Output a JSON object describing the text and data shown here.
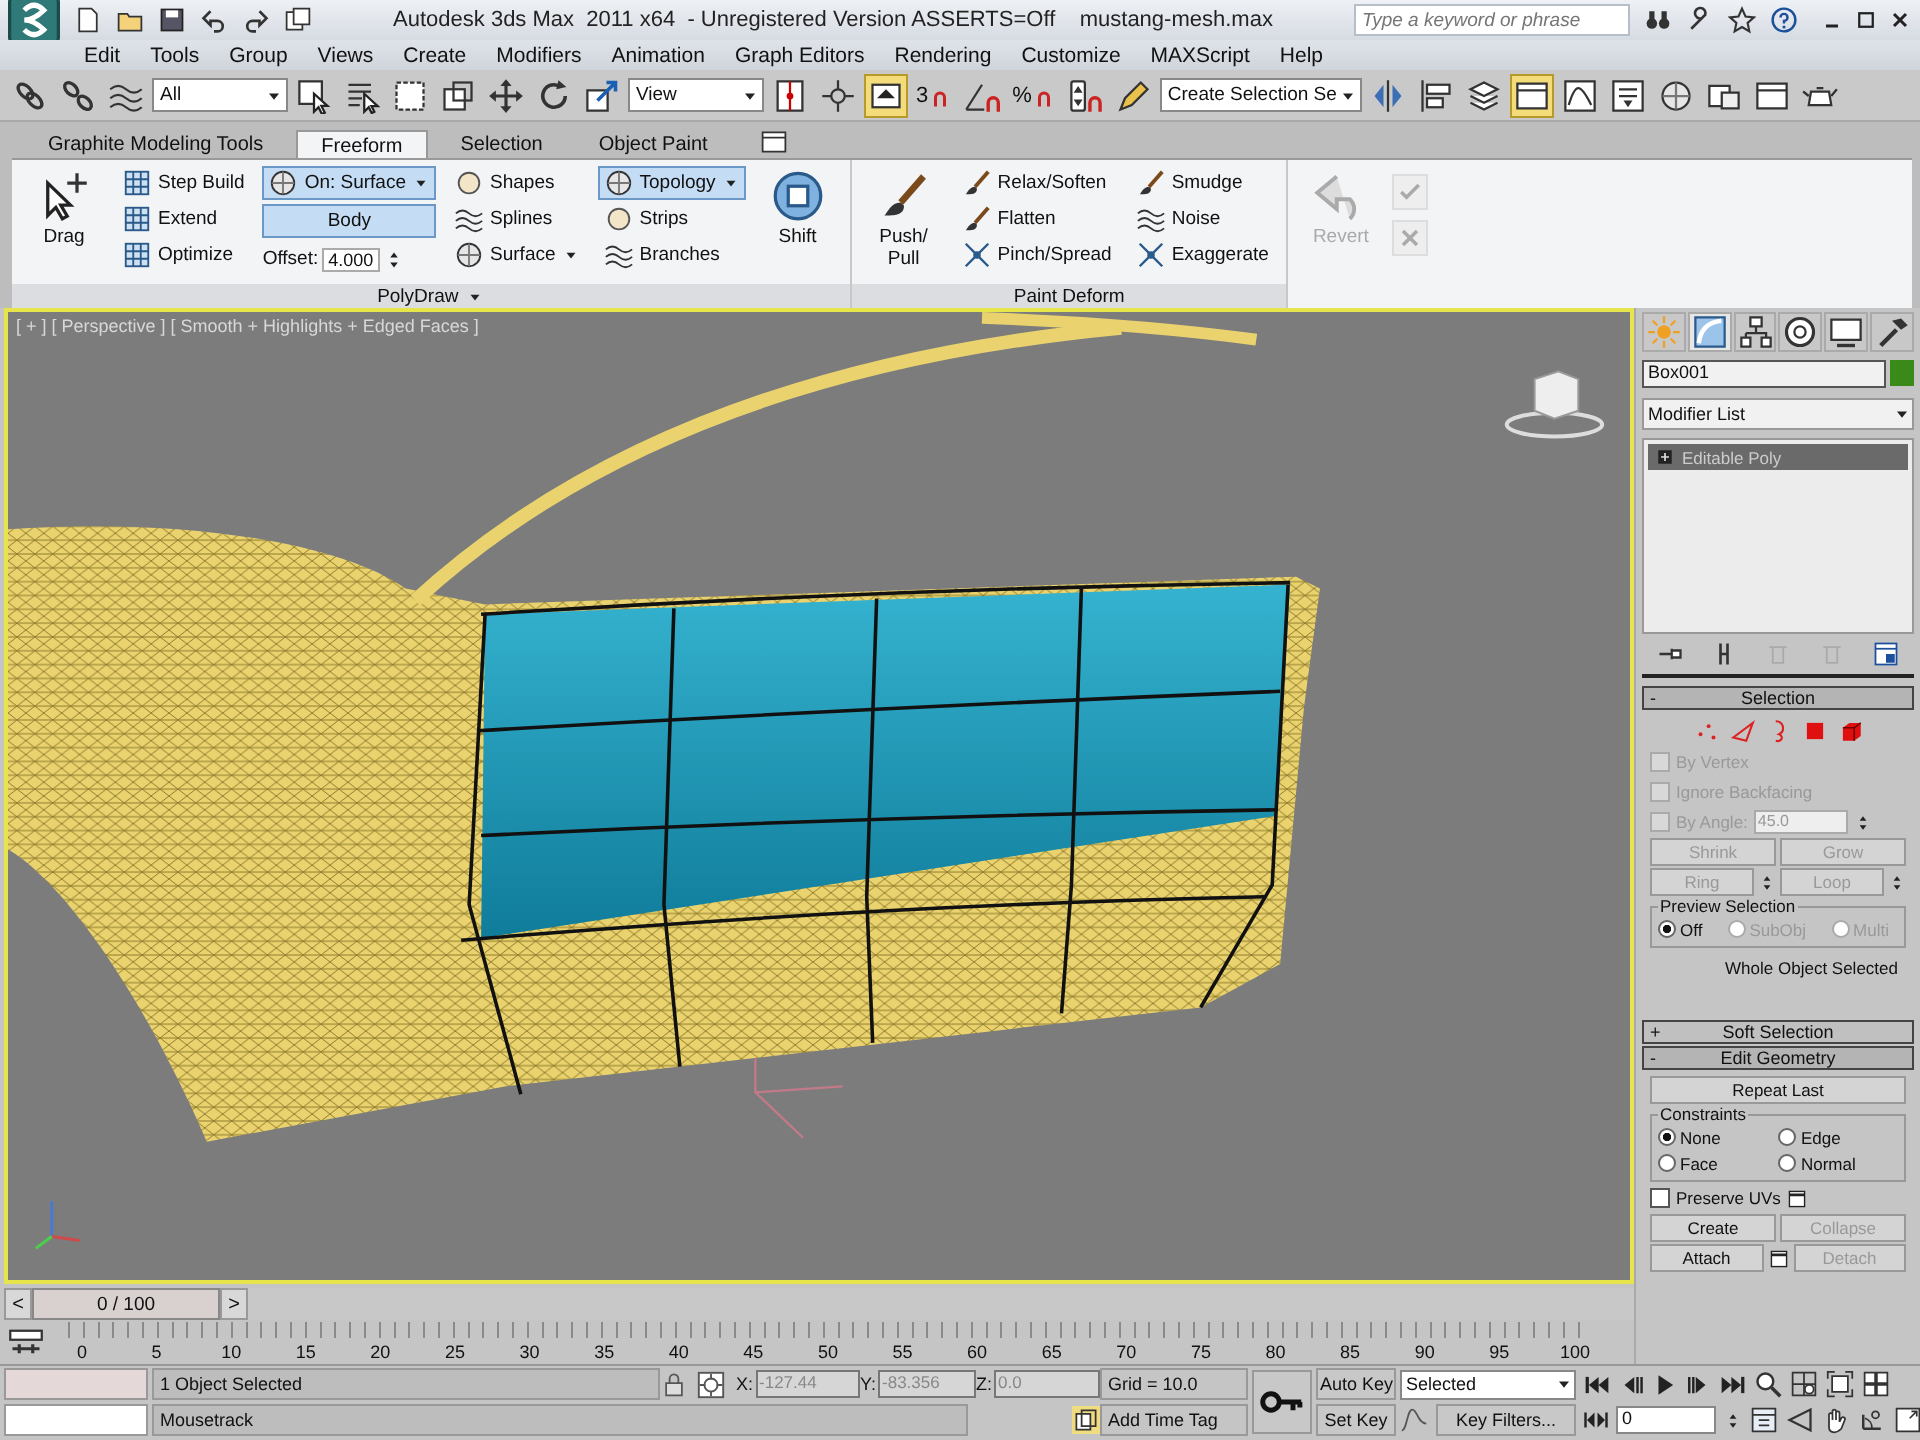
{
  "title_bar": {
    "title": "Autodesk 3ds Max  2011 x64  - Unregistered Version ASSERTS=Off    mustang-mesh.max",
    "search": {
      "placeholder": "Type a keyword or phrase"
    }
  },
  "menu": [
    "Edit",
    "Tools",
    "Group",
    "Views",
    "Create",
    "Modifiers",
    "Animation",
    "Graph Editors",
    "Rendering",
    "Customize",
    "MAXScript",
    "Help"
  ],
  "main_toolbar": [
    {
      "kind": "button",
      "on": false
    },
    {
      "kind": "button",
      "on": false
    },
    {
      "kind": "button",
      "on": false
    },
    {
      "kind": "dropdown",
      "value": "All"
    },
    {
      "kind": "button",
      "on": false
    },
    {
      "kind": "button",
      "on": false
    },
    {
      "kind": "button",
      "on": false
    },
    {
      "kind": "button",
      "on": false
    },
    {
      "kind": "button",
      "on": false
    },
    {
      "kind": "button",
      "on": false
    },
    {
      "kind": "button",
      "on": false
    },
    {
      "kind": "dropdown",
      "value": "View"
    },
    {
      "kind": "button",
      "on": false
    },
    {
      "kind": "button",
      "on": false
    },
    {
      "kind": "button",
      "on": true
    },
    {
      "kind": "snap",
      "label": "3",
      "on": false
    },
    {
      "kind": "button",
      "on": false
    },
    {
      "kind": "snap",
      "label": "%",
      "on": false
    },
    {
      "kind": "button",
      "on": false
    },
    {
      "kind": "button",
      "on": false
    },
    {
      "kind": "dropdown",
      "value": "Create Selection Se"
    },
    {
      "kind": "button",
      "on": false
    },
    {
      "kind": "button",
      "on": false
    },
    {
      "kind": "button",
      "on": false
    },
    {
      "kind": "button",
      "on": true
    },
    {
      "kind": "button",
      "on": false
    },
    {
      "kind": "button",
      "on": false
    },
    {
      "kind": "button",
      "on": false
    },
    {
      "kind": "button",
      "on": false
    },
    {
      "kind": "button",
      "on": false
    },
    {
      "kind": "button",
      "on": false
    }
  ],
  "ribbon": {
    "tabs": [
      {
        "label": "Graphite Modeling Tools",
        "selected": false
      },
      {
        "label": "Freeform",
        "selected": true
      },
      {
        "label": "Selection",
        "selected": false
      },
      {
        "label": "Object Paint",
        "selected": false
      }
    ],
    "panels": [
      {
        "title": "PolyDraw",
        "columns": [
          [
            {
              "kind": "large",
              "label": "Drag"
            }
          ],
          [
            {
              "kind": "small",
              "label": "Step Build"
            },
            {
              "kind": "small",
              "label": "Extend"
            },
            {
              "kind": "small",
              "label": "Optimize"
            }
          ],
          [
            {
              "kind": "toggle",
              "label": "On: Surface",
              "selected": true,
              "caret": true
            },
            {
              "kind": "field",
              "value": "Body"
            },
            {
              "kind": "spinner",
              "label": "Offset:",
              "value": "4.000"
            }
          ],
          [
            {
              "kind": "small",
              "label": "Shapes"
            },
            {
              "kind": "small",
              "label": "Splines"
            },
            {
              "kind": "small",
              "label": "Surface",
              "caret": true
            }
          ],
          [
            {
              "kind": "toggle",
              "label": "Topology",
              "selected": true,
              "caret": true
            },
            {
              "kind": "small",
              "label": "Strips"
            },
            {
              "kind": "small",
              "label": "Branches"
            }
          ],
          [
            {
              "kind": "large",
              "label": "Shift"
            }
          ]
        ]
      },
      {
        "title": "Paint Deform",
        "columns": [
          [
            {
              "kind": "large",
              "label": "Push/ Pull"
            }
          ],
          [
            {
              "kind": "small",
              "label": "Relax/Soften"
            },
            {
              "kind": "small",
              "label": "Flatten"
            },
            {
              "kind": "small",
              "label": "Pinch/Spread"
            }
          ],
          [
            {
              "kind": "small",
              "label": "Smudge"
            },
            {
              "kind": "small",
              "label": "Noise"
            },
            {
              "kind": "small",
              "label": "Exaggerate"
            }
          ]
        ]
      },
      {
        "columns": [
          [
            {
              "kind": "large",
              "label": "Revert",
              "disabled": true
            }
          ],
          [
            {
              "kind": "icon",
              "disabled": true
            },
            {
              "kind": "icon",
              "disabled": true
            }
          ]
        ]
      }
    ]
  },
  "viewport": {
    "label": "[ + ] [ Perspective ] [ Smooth + Highlights + Edged Faces ]",
    "active": true
  },
  "timeline": {
    "prev": "<",
    "position": "0 / 100",
    "level": 0,
    "next": ">",
    "ruler": [
      "0",
      "5",
      "10",
      "15",
      "20",
      "25",
      "30",
      "35",
      "40",
      "45",
      "50",
      "55",
      "60",
      "65",
      "70",
      "75",
      "80",
      "85",
      "90",
      "95",
      "100"
    ]
  },
  "command_panel": {
    "tabs": [
      {
        "selected": false
      },
      {
        "selected": true
      },
      {
        "selected": false
      },
      {
        "selected": false
      },
      {
        "selected": false
      },
      {
        "selected": false
      }
    ],
    "object_name": "Box001",
    "modifier_list": "Modifier List",
    "stack": [
      {
        "label": "Editable Poly",
        "selected": true
      }
    ],
    "rollouts": [
      {
        "toggle": "-",
        "title": "Selection",
        "expanded": true,
        "items": [
          {
            "kind": "subobject_icons"
          },
          {
            "kind": "checkbox",
            "label": "By Vertex",
            "checked": false,
            "disabled": true
          },
          {
            "kind": "checkbox",
            "label": "Ignore Backfacing",
            "checked": false,
            "disabled": true
          },
          {
            "kind": "checkbox_spinner",
            "label": "By Angle:",
            "checked": false,
            "disabled": true,
            "value": "45.0"
          },
          {
            "kind": "buttons",
            "buttons": [
              {
                "label": "Shrink",
                "disabled": true
              },
              {
                "label": "Grow",
                "disabled": true
              }
            ]
          },
          {
            "kind": "buttons",
            "buttons": [
              {
                "label": "Ring",
                "disabled": true,
                "spinner": true
              },
              {
                "label": "Loop",
                "disabled": true,
                "spinner": true
              }
            ]
          },
          {
            "kind": "group",
            "title": "Preview Selection",
            "radios": [
              {
                "label": "Off",
                "selected": true,
                "disabled": false
              },
              {
                "label": "SubObj",
                "selected": false,
                "disabled": true
              },
              {
                "label": "Multi",
                "selected": false,
                "disabled": true
              }
            ]
          },
          {
            "kind": "text",
            "text": "Whole Object Selected"
          }
        ]
      },
      {
        "toggle": "+",
        "title": "Soft Selection",
        "expanded": false
      },
      {
        "toggle": "-",
        "title": "Edit Geometry",
        "expanded": true,
        "items": [
          {
            "kind": "buttons",
            "buttons": [
              {
                "label": "Repeat Last",
                "disabled": false
              }
            ]
          },
          {
            "kind": "group",
            "title": "Constraints",
            "radios": [
              {
                "label": "None",
                "selected": true,
                "disabled": false
              },
              {
                "label": "Edge",
                "selected": false,
                "disabled": false
              },
              {
                "label": "Face",
                "selected": false,
                "disabled": false
              },
              {
                "label": "Normal",
                "selected": false,
                "disabled": false
              }
            ]
          },
          {
            "kind": "checkbox",
            "label": "Preserve UVs",
            "checked": false,
            "disabled": false,
            "settings": true
          },
          {
            "kind": "buttons",
            "buttons": [
              {
                "label": "Create",
                "disabled": false
              },
              {
                "label": "Collapse",
                "disabled": true
              }
            ]
          },
          {
            "kind": "buttons",
            "buttons": [
              {
                "label": "Attach",
                "disabled": false,
                "settings": true
              },
              {
                "label": "Detach",
                "disabled": true
              }
            ]
          }
        ]
      }
    ]
  },
  "status_bar": {
    "prompt": "1 Object Selected",
    "prompt_line_2": "Mousetrack",
    "coords": [
      {
        "axis": "X:",
        "value": "-127.44"
      },
      {
        "axis": "Y:",
        "value": "-83.356"
      },
      {
        "axis": "Z:",
        "value": "0.0"
      }
    ],
    "grid": "Grid = 10.0",
    "time_tag": "Add Time Tag",
    "auto_key": "Auto Key",
    "set_key": "Set Key",
    "key_mode": "Selected",
    "key_filters": "Key Filters...",
    "frame": "0"
  }
}
